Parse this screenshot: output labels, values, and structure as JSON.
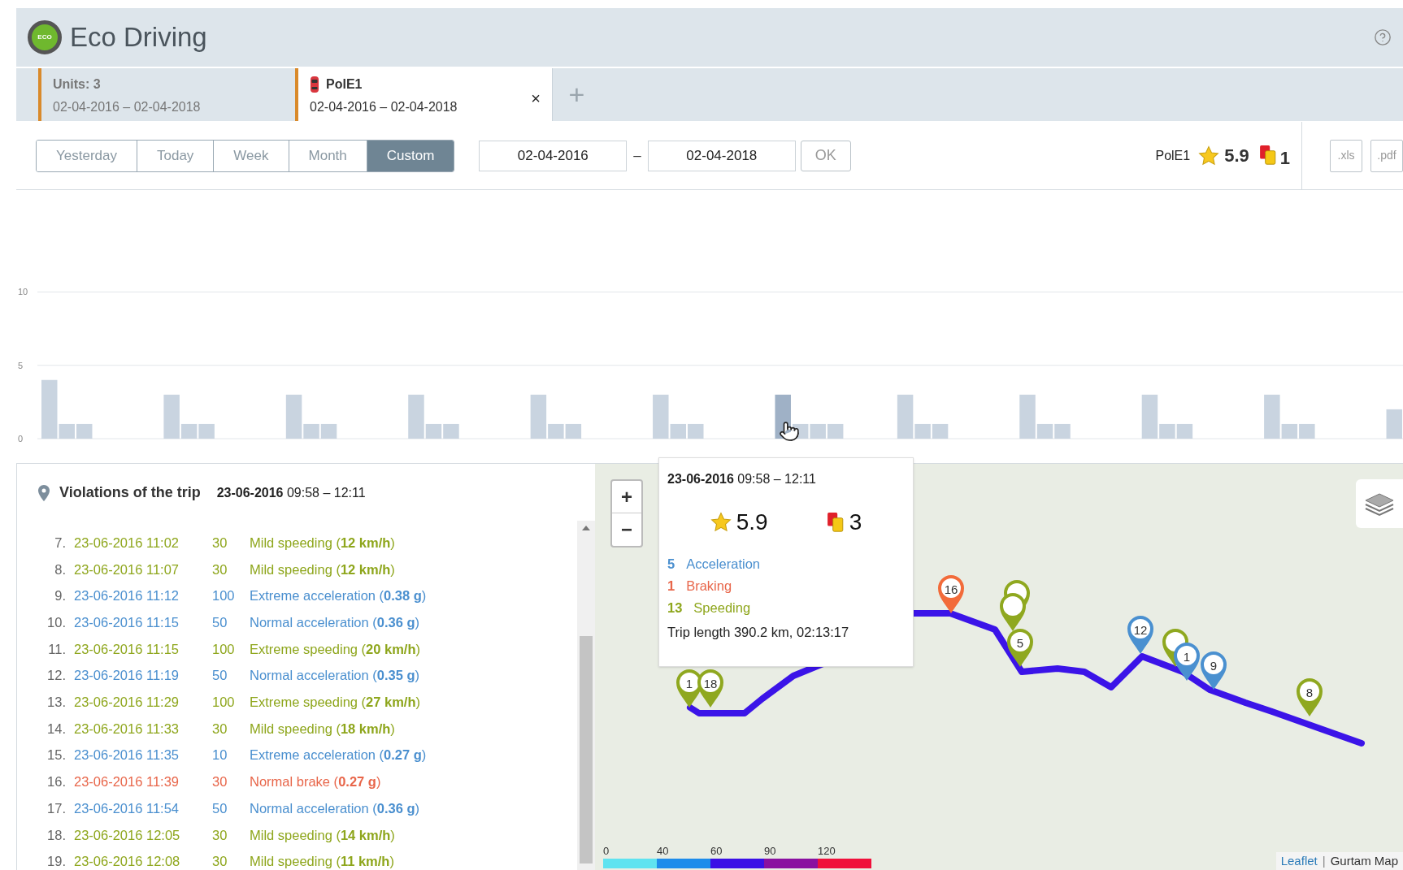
{
  "header": {
    "logo_text": "ECO",
    "title": "Eco Driving"
  },
  "tabs": [
    {
      "kind": "units",
      "title": "Units: 3",
      "dates": "02-04-2016 – 02-04-2018",
      "selected": false
    },
    {
      "kind": "unit",
      "title": "PolE1",
      "dates": "02-04-2016 – 02-04-2018",
      "selected": true,
      "close": "×"
    }
  ],
  "add_tab": "+",
  "periods": [
    {
      "label": "Yesterday",
      "selected": false
    },
    {
      "label": "Today",
      "selected": false
    },
    {
      "label": "Week",
      "selected": false
    },
    {
      "label": "Month",
      "selected": false
    },
    {
      "label": "Custom",
      "selected": true
    }
  ],
  "date_from": "02-04-2016",
  "date_separator": "–",
  "date_to": "02-04-2018",
  "ok": "OK",
  "summary": {
    "unit": "PolE1",
    "rating": "5.9",
    "violations": "1"
  },
  "exports": [
    ".xls",
    ".pdf"
  ],
  "chart_data": {
    "type": "bar",
    "ylim": [
      0,
      17
    ],
    "yticks": [
      0,
      5,
      10
    ],
    "series": [
      {
        "color": "#c9d4e0",
        "values": [
          4,
          1,
          1,
          null,
          null,
          null,
          null,
          3,
          1,
          1,
          null,
          null,
          null,
          null,
          3,
          1,
          1,
          null,
          null,
          null,
          null,
          3,
          1,
          1,
          null,
          null,
          null,
          null,
          3,
          1,
          1,
          null,
          null,
          null,
          null,
          3,
          1,
          1,
          null,
          null,
          null,
          null,
          null,
          1,
          1,
          1,
          null,
          null,
          null,
          3,
          1,
          1,
          null,
          null,
          null,
          null,
          3,
          1,
          1,
          null,
          null,
          null,
          null,
          3,
          1,
          1,
          null,
          null,
          null,
          null,
          3,
          1,
          1,
          null,
          null,
          null,
          null,
          2
        ]
      },
      {
        "color": "#9fb1c6",
        "values": [
          null,
          null,
          null,
          null,
          null,
          null,
          null,
          null,
          null,
          null,
          null,
          null,
          null,
          null,
          null,
          null,
          null,
          null,
          null,
          null,
          null,
          null,
          null,
          null,
          null,
          null,
          null,
          null,
          null,
          null,
          null,
          null,
          null,
          null,
          null,
          null,
          null,
          null,
          null,
          null,
          null,
          null,
          3,
          null,
          null,
          null,
          null,
          null,
          null,
          null,
          null,
          null,
          null,
          null,
          null,
          null,
          null,
          null,
          null,
          null,
          null,
          null,
          null,
          null,
          null,
          null,
          null,
          null,
          null,
          null,
          null,
          null,
          null,
          null,
          null,
          null,
          null,
          null
        ]
      }
    ]
  },
  "trip_panel": {
    "title": "Violations of the trip",
    "period": "**23-06-2016** 09:58 – 12:11",
    "rows": [
      {
        "index": "7.",
        "time": "23-06-2016 11:02",
        "points": "30",
        "kind": "speeding",
        "text": "Mild speeding (**12 km/h**)"
      },
      {
        "index": "8.",
        "time": "23-06-2016 11:07",
        "points": "30",
        "kind": "speeding",
        "text": "Mild speeding (**12 km/h**)"
      },
      {
        "index": "9.",
        "time": "23-06-2016 11:12",
        "points": "100",
        "kind": "acceleration",
        "text": "Extreme acceleration (**0.38 g**)"
      },
      {
        "index": "10.",
        "time": "23-06-2016 11:15",
        "points": "50",
        "kind": "acceleration",
        "text": "Normal acceleration (**0.36 g**)"
      },
      {
        "index": "11.",
        "time": "23-06-2016 11:15",
        "points": "100",
        "kind": "speeding",
        "text": "Extreme speeding (**20 km/h**)"
      },
      {
        "index": "12.",
        "time": "23-06-2016 11:19",
        "points": "50",
        "kind": "acceleration",
        "text": "Normal acceleration (**0.35 g**)"
      },
      {
        "index": "13.",
        "time": "23-06-2016 11:29",
        "points": "100",
        "kind": "speeding",
        "text": "Extreme speeding (**27 km/h**)"
      },
      {
        "index": "14.",
        "time": "23-06-2016 11:33",
        "points": "30",
        "kind": "speeding",
        "text": "Mild speeding (**18 km/h**)"
      },
      {
        "index": "15.",
        "time": "23-06-2016 11:35",
        "points": "10",
        "kind": "acceleration",
        "text": "Extreme acceleration (**0.27 g**)"
      },
      {
        "index": "16.",
        "time": "23-06-2016 11:39",
        "points": "30",
        "kind": "braking",
        "text": "Normal brake (**0.27 g**)"
      },
      {
        "index": "17.",
        "time": "23-06-2016 11:54",
        "points": "50",
        "kind": "acceleration",
        "text": "Normal acceleration (**0.36 g**)"
      },
      {
        "index": "18.",
        "time": "23-06-2016 12:05",
        "points": "30",
        "kind": "speeding",
        "text": "Mild speeding (**14 km/h**)"
      },
      {
        "index": "19.",
        "time": "23-06-2016 12:08",
        "points": "30",
        "kind": "speeding",
        "text": "Mild speeding (**11 km/h**)"
      }
    ]
  },
  "map": {
    "zoom_in": "+",
    "zoom_out": "−",
    "markers": [
      {
        "label": "1",
        "kind": "speeding"
      },
      {
        "label": "18",
        "kind": "speeding"
      },
      {
        "label": "16",
        "kind": "braking"
      },
      {
        "kind": "speeding"
      },
      {
        "kind": "speeding"
      },
      {
        "label": "5",
        "kind": "speeding"
      },
      {
        "label": "12",
        "kind": "acceleration"
      },
      {
        "kind": "speeding"
      },
      {
        "label": "1",
        "kind": "acceleration"
      },
      {
        "label": "9",
        "kind": "acceleration"
      },
      {
        "label": "8",
        "kind": "speeding"
      }
    ],
    "legend": [
      "0",
      "40",
      "60",
      "90",
      "120"
    ],
    "attribution": {
      "link": "Leaflet",
      "separator": "|",
      "source": "Gurtam Map"
    }
  },
  "tooltip": {
    "period": "**23-06-2016** 09:58 – 12:11",
    "rating": "5.9",
    "violations": "3",
    "counts": [
      {
        "count": "5",
        "label": "Acceleration",
        "kind": "acceleration"
      },
      {
        "count": "1",
        "label": "Braking",
        "kind": "braking"
      },
      {
        "count": "13",
        "label": "Speeding",
        "kind": "speeding"
      }
    ],
    "trip_length": "Trip length 390.2 km, 02:13:17"
  }
}
